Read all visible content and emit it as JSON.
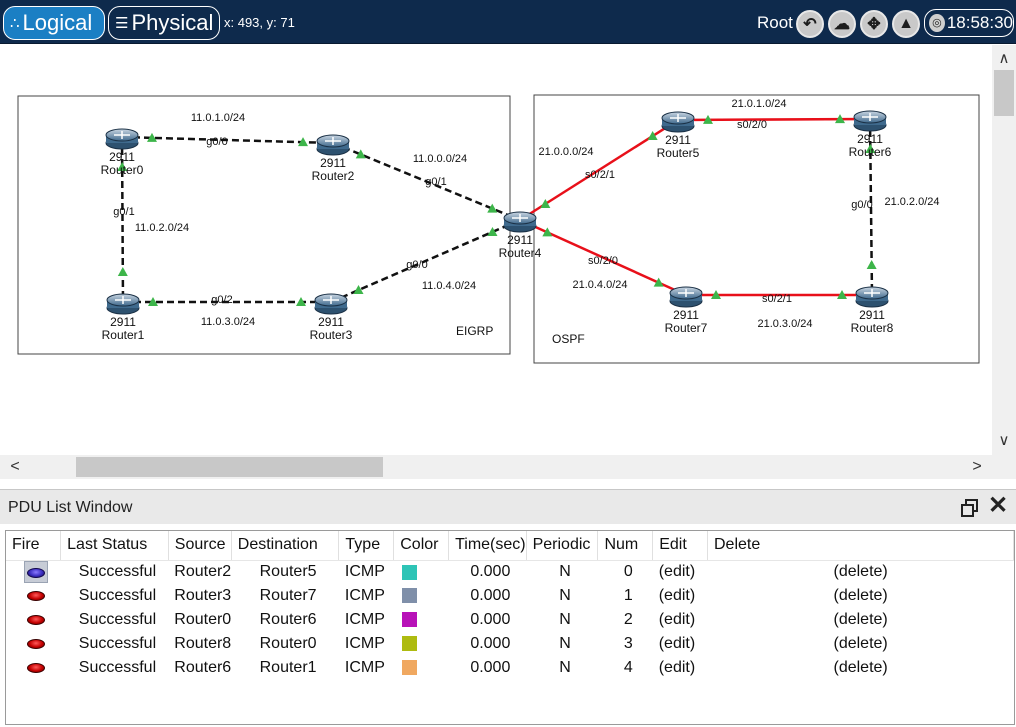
{
  "topbar": {
    "logical_label": "Logical",
    "physical_label": "Physical",
    "coords": "x: 493, y: 71",
    "root_label": "Root",
    "clock": "18:58:30",
    "icons": [
      "back-icon",
      "cloud-add-icon",
      "move-icon",
      "landscape-icon",
      "globe-icon"
    ]
  },
  "topology": {
    "areas": [
      {
        "label": "EIGRP"
      },
      {
        "label": "OSPF"
      }
    ],
    "devices": [
      {
        "id": "r0",
        "model": "2911",
        "name": "Router0"
      },
      {
        "id": "r1",
        "model": "2911",
        "name": "Router1"
      },
      {
        "id": "r2",
        "model": "2911",
        "name": "Router2"
      },
      {
        "id": "r3",
        "model": "2911",
        "name": "Router3"
      },
      {
        "id": "r4",
        "model": "2911",
        "name": "Router4"
      },
      {
        "id": "r5",
        "model": "2911",
        "name": "Router5"
      },
      {
        "id": "r6",
        "model": "2911",
        "name": "Router6"
      },
      {
        "id": "r7",
        "model": "2911",
        "name": "Router7"
      },
      {
        "id": "r8",
        "model": "2911",
        "name": "Router8"
      }
    ],
    "links": [
      {
        "from": "r0",
        "to": "r2",
        "type": "ethernet",
        "network": "11.0.1.0/24",
        "port": "g0/0"
      },
      {
        "from": "r0",
        "to": "r1",
        "type": "ethernet",
        "network": "11.0.2.0/24",
        "port": "g0/1"
      },
      {
        "from": "r1",
        "to": "r3",
        "type": "ethernet",
        "network": "11.0.3.0/24",
        "port": "g0/2"
      },
      {
        "from": "r2",
        "to": "r4",
        "type": "ethernet",
        "network": "11.0.0.0/24",
        "port": "g0/1"
      },
      {
        "from": "r3",
        "to": "r4",
        "type": "ethernet",
        "network": "11.0.4.0/24",
        "port": "g0/0"
      },
      {
        "from": "r4",
        "to": "r5",
        "type": "serial",
        "network": "21.0.0.0/24",
        "port": "s0/2/1"
      },
      {
        "from": "r4",
        "to": "r7",
        "type": "serial",
        "network": "21.0.4.0/24",
        "port": "s0/2/0"
      },
      {
        "from": "r5",
        "to": "r6",
        "type": "serial",
        "network": "21.0.1.0/24",
        "port": "s0/2/0"
      },
      {
        "from": "r6",
        "to": "r8",
        "type": "ethernet",
        "network": "21.0.2.0/24",
        "port": "g0/0"
      },
      {
        "from": "r7",
        "to": "r8",
        "type": "serial",
        "network": "21.0.3.0/24",
        "port": "s0/2/1"
      }
    ],
    "colors": {
      "ethernet": "#111111",
      "serial": "#e8101a",
      "link_light": "#3db54a"
    }
  },
  "pdu": {
    "title": "PDU List Window",
    "columns": [
      "Fire",
      "Last Status",
      "Source",
      "Destination",
      "Type",
      "Color",
      "Time(sec)",
      "Periodic",
      "Num",
      "Edit",
      "Delete"
    ],
    "rows": [
      {
        "status": "Successful",
        "source": "Router2",
        "destination": "Router5",
        "type": "ICMP",
        "color": "#2ec4b6",
        "time": "0.000",
        "periodic": "N",
        "num": "0",
        "edit": "(edit)",
        "delete": "(delete)",
        "selected": true
      },
      {
        "status": "Successful",
        "source": "Router3",
        "destination": "Router7",
        "type": "ICMP",
        "color": "#7f8fa9",
        "time": "0.000",
        "periodic": "N",
        "num": "1",
        "edit": "(edit)",
        "delete": "(delete)",
        "selected": false
      },
      {
        "status": "Successful",
        "source": "Router0",
        "destination": "Router6",
        "type": "ICMP",
        "color": "#b812b8",
        "time": "0.000",
        "periodic": "N",
        "num": "2",
        "edit": "(edit)",
        "delete": "(delete)",
        "selected": false
      },
      {
        "status": "Successful",
        "source": "Router8",
        "destination": "Router0",
        "type": "ICMP",
        "color": "#aebb10",
        "time": "0.000",
        "periodic": "N",
        "num": "3",
        "edit": "(edit)",
        "delete": "(delete)",
        "selected": false
      },
      {
        "status": "Successful",
        "source": "Router6",
        "destination": "Router1",
        "type": "ICMP",
        "color": "#f0a860",
        "time": "0.000",
        "periodic": "N",
        "num": "4",
        "edit": "(edit)",
        "delete": "(delete)",
        "selected": false
      }
    ]
  }
}
